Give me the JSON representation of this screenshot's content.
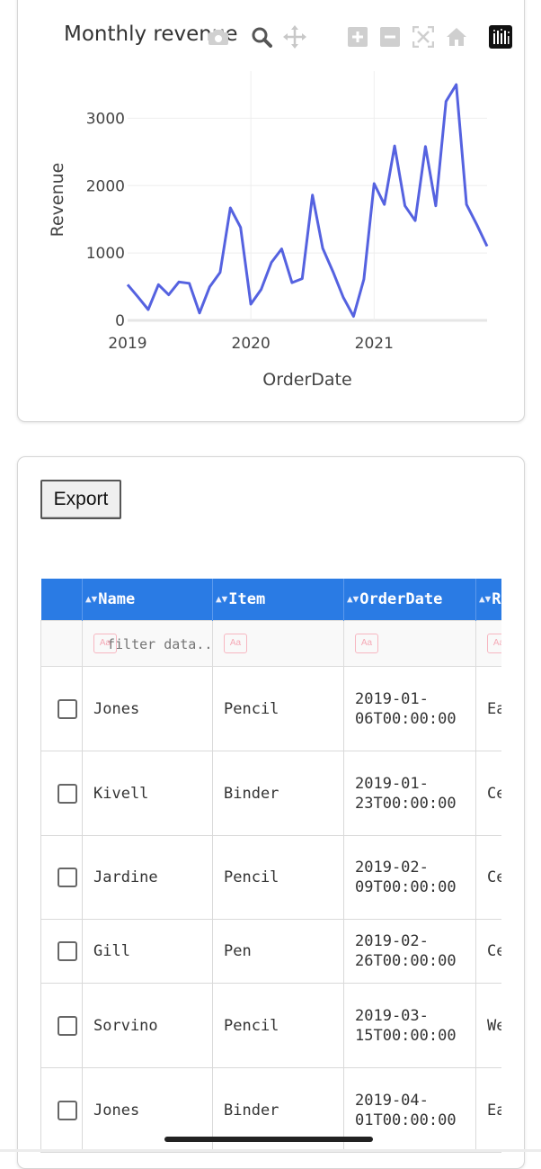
{
  "chart": {
    "title": "Monthly revenue",
    "modebar_icons": [
      "camera-icon",
      "zoom-icon",
      "pan-icon",
      "zoom-in-icon",
      "zoom-out-icon",
      "autoscale-icon",
      "home-icon",
      "plotly-logo-icon"
    ]
  },
  "chart_data": {
    "type": "line",
    "title": "Monthly revenue",
    "xlabel": "OrderDate",
    "ylabel": "Revenue",
    "x_tick_labels": [
      "2019",
      "2020",
      "2021"
    ],
    "y_ticks": [
      0,
      1000,
      2000,
      3000
    ],
    "ylim": [
      0,
      3700
    ],
    "xlim": [
      "2019-01",
      "2021-12"
    ],
    "grid": true,
    "series_color": "#5562e0",
    "x": [
      "2019-01",
      "2019-02",
      "2019-03",
      "2019-04",
      "2019-05",
      "2019-06",
      "2019-07",
      "2019-08",
      "2019-09",
      "2019-10",
      "2019-11",
      "2019-12",
      "2020-01",
      "2020-02",
      "2020-03",
      "2020-04",
      "2020-05",
      "2020-06",
      "2020-07",
      "2020-08",
      "2020-09",
      "2020-10",
      "2020-11",
      "2020-12",
      "2021-01",
      "2021-02",
      "2021-03",
      "2021-04",
      "2021-05",
      "2021-06",
      "2021-07",
      "2021-08",
      "2021-09",
      "2021-10",
      "2021-11",
      "2021-12"
    ],
    "values": [
      530,
      350,
      160,
      530,
      380,
      570,
      550,
      110,
      500,
      710,
      1670,
      1380,
      240,
      460,
      860,
      1060,
      560,
      620,
      1860,
      1070,
      720,
      340,
      60,
      610,
      2030,
      1720,
      2590,
      1700,
      1480,
      2580,
      1700,
      3250,
      3500,
      1720,
      1420,
      1100
    ]
  },
  "table": {
    "export_label": "Export",
    "columns": [
      "Name",
      "Item",
      "OrderDate",
      "Region"
    ],
    "filter_placeholder": "filter data...",
    "aa_label": "Aa",
    "rows": [
      {
        "name": "Jones",
        "item": "Pencil",
        "date": "2019-01-\n06T00:00:00",
        "region": "East"
      },
      {
        "name": "Kivell",
        "item": "Binder",
        "date": "2019-01-\n23T00:00:00",
        "region": "Central"
      },
      {
        "name": "Jardine",
        "item": "Pencil",
        "date": "2019-02-\n09T00:00:00",
        "region": "Central"
      },
      {
        "name": "Gill",
        "item": "Pen",
        "date": "2019-02-\n26T00:00:00",
        "region": "Central"
      },
      {
        "name": "Sorvino",
        "item": "Pencil",
        "date": "2019-03-\n15T00:00:00",
        "region": "West"
      },
      {
        "name": "Jones",
        "item": "Binder",
        "date": "2019-04-\n01T00:00:00",
        "region": "East"
      }
    ]
  },
  "colors": {
    "header_bg": "#2a7be4",
    "line": "#5562e0",
    "aa_badge": "#f5a9b6"
  }
}
